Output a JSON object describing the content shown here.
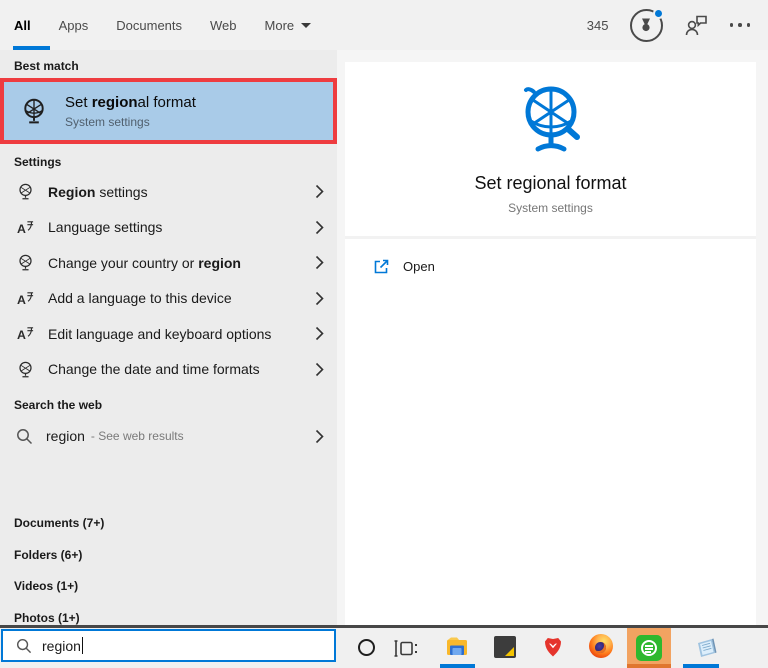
{
  "tabs": [
    {
      "label": "All"
    },
    {
      "label": "Apps"
    },
    {
      "label": "Documents"
    },
    {
      "label": "Web"
    },
    {
      "label": "More"
    }
  ],
  "header": {
    "notification_count": "345"
  },
  "left": {
    "best_match": {
      "section": "Best match",
      "title_before": "Set ",
      "title_match": "region",
      "title_after": "al format",
      "subtitle": "System settings"
    },
    "settings": {
      "section": "Settings",
      "items": [
        {
          "before": "",
          "match": "Region",
          "after": " settings",
          "icon": "globe"
        },
        {
          "before": "Language settings",
          "match": "",
          "after": "",
          "icon": "language"
        },
        {
          "before": "Change your country or ",
          "match": "region",
          "after": "",
          "icon": "globe"
        },
        {
          "before": "Add a language to this device",
          "match": "",
          "after": "",
          "icon": "language"
        },
        {
          "before": "Edit language and keyboard options",
          "match": "",
          "after": "",
          "icon": "language"
        },
        {
          "before": "Change the date and time formats",
          "match": "",
          "after": "",
          "icon": "globe"
        }
      ]
    },
    "web": {
      "section": "Search the web",
      "query": "region",
      "hint": "- See web results"
    },
    "sections": [
      {
        "label": "Documents (7+)"
      },
      {
        "label": "Folders (6+)"
      },
      {
        "label": "Videos (1+)"
      },
      {
        "label": "Photos (1+)"
      }
    ]
  },
  "preview": {
    "title": "Set regional format",
    "subtitle": "System settings",
    "open_label": "Open"
  },
  "search": {
    "value": "region"
  },
  "icons": {
    "header": [
      "trophy-icon",
      "feedback-icon",
      "more-options-icon"
    ],
    "left_list": [
      "globe-icon",
      "language-icon",
      "chevron-right-icon",
      "search-icon"
    ],
    "taskbar": [
      "cortana-icon",
      "task-view-icon",
      "file-explorer-icon",
      "code-app-icon",
      "brave-icon",
      "firefox-icon",
      "greenshot-icon",
      "notepad-icon"
    ]
  },
  "colors": {
    "accent": "#0078d7",
    "best_match_bg": "#a9cbe8",
    "annotation_red": "#ee3c40",
    "taskbar_highlight": "#f2a361"
  }
}
